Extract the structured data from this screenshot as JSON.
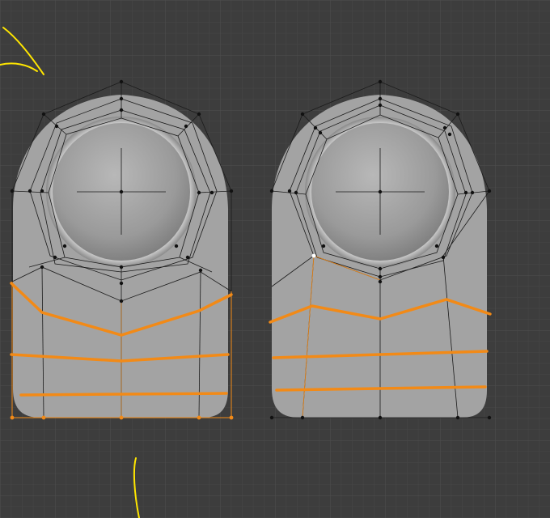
{
  "viewport": {
    "background": "#3d3d3d",
    "grid_minor_color": "#474747",
    "grid_major_color": "#4f4f4f"
  },
  "objects": [
    {
      "id": "left-mesh",
      "fill": "#a3a3a3",
      "edge_color": "#1a1a1a",
      "selection_color": "#f28a17",
      "vertex_color": "#111111"
    },
    {
      "id": "right-mesh",
      "fill": "#a3a3a3",
      "edge_color": "#1a1a1a",
      "selection_color": "#f28a17",
      "vertex_color": "#111111"
    }
  ],
  "annotations": {
    "stroke_color": "#ffe600",
    "items": [
      "top-left-arrow-stroke",
      "bottom-hook-stroke"
    ]
  }
}
